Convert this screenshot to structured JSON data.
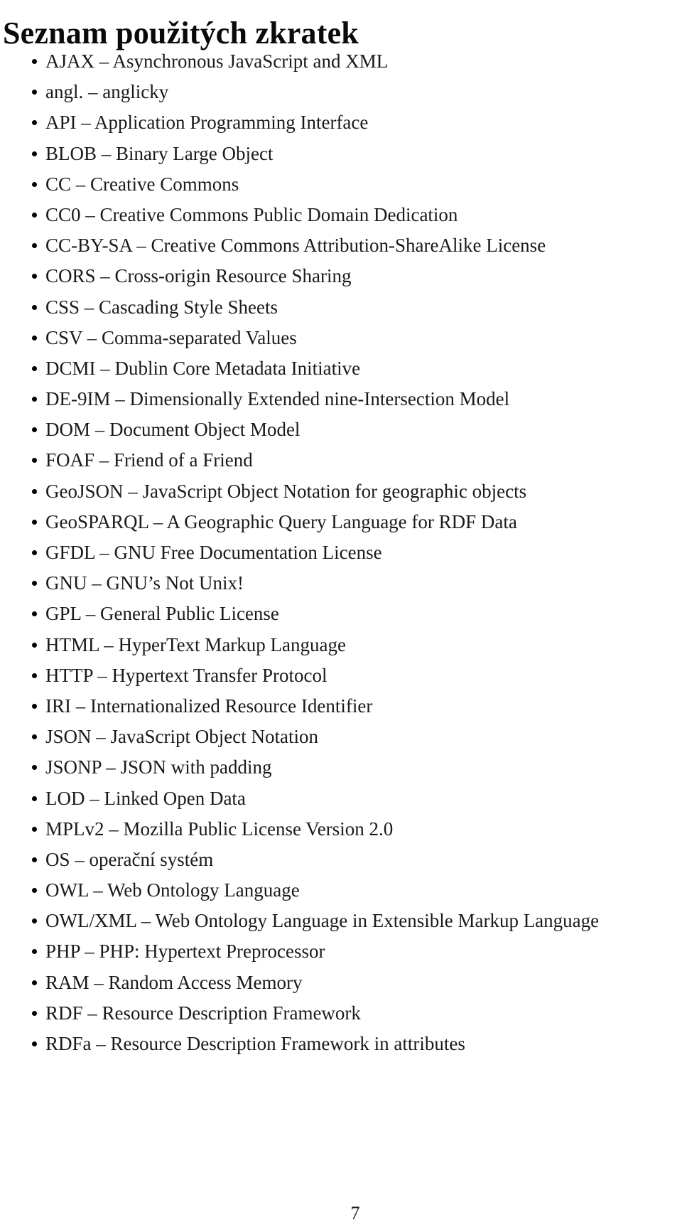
{
  "document": {
    "title": "Seznam použitých zkratek",
    "page_number": "7",
    "abbreviations": [
      {
        "text": "AJAX – Asynchronous JavaScript and XML"
      },
      {
        "text": "angl. – anglicky"
      },
      {
        "text": "API – Application Programming Interface"
      },
      {
        "text": "BLOB – Binary Large Object"
      },
      {
        "text": "CC – Creative Commons"
      },
      {
        "text": "CC0 – Creative Commons Public Domain Dedication"
      },
      {
        "text": "CC-BY-SA – Creative Commons Attribution-ShareAlike License"
      },
      {
        "text": "CORS – Cross-origin Resource Sharing"
      },
      {
        "text": "CSS – Cascading Style Sheets"
      },
      {
        "text": "CSV – Comma-separated Values"
      },
      {
        "text": "DCMI – Dublin Core Metadata Initiative"
      },
      {
        "text": "DE-9IM – Dimensionally Extended nine-Intersection Model"
      },
      {
        "text": "DOM – Document Object Model"
      },
      {
        "text": "FOAF – Friend of a Friend"
      },
      {
        "text": "GeoJSON – JavaScript Object Notation for geographic objects"
      },
      {
        "text": "GeoSPARQL – A Geographic Query Language for RDF Data"
      },
      {
        "text": "GFDL – GNU Free Documentation License"
      },
      {
        "text": "GNU – GNU’s Not Unix!"
      },
      {
        "text": "GPL – General Public License"
      },
      {
        "text": "HTML – HyperText Markup Language"
      },
      {
        "text": "HTTP – Hypertext Transfer Protocol"
      },
      {
        "text": "IRI – Internationalized Resource Identifier"
      },
      {
        "text": "JSON – JavaScript Object Notation"
      },
      {
        "text": "JSONP – JSON with padding"
      },
      {
        "text": "LOD – Linked Open Data"
      },
      {
        "text": "MPLv2 – Mozilla Public License Version 2.0"
      },
      {
        "text": "OS – operační systém"
      },
      {
        "text": "OWL – Web Ontology Language"
      },
      {
        "text": "OWL/XML – Web Ontology Language in Extensible Markup Language"
      },
      {
        "text": "PHP – PHP: Hypertext Preprocessor"
      },
      {
        "text": "RAM – Random Access Memory"
      },
      {
        "text": "RDF – Resource Description Framework"
      },
      {
        "text": "RDFa – Resource Description Framework in attributes"
      }
    ]
  }
}
